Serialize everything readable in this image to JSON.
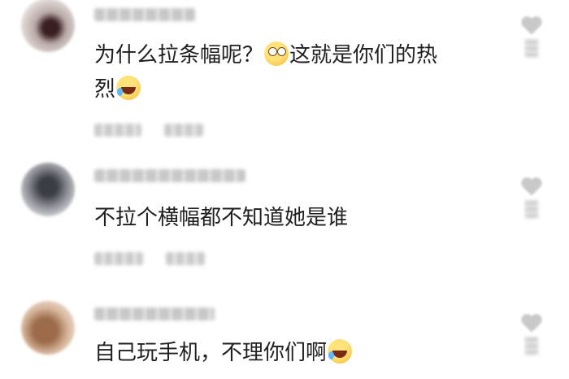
{
  "comments": [
    {
      "text_before": "为什么拉条幅呢？",
      "emoji_1": "rolling-eyes-emoji",
      "text_middle": "这就是你们的热",
      "text_line2": "烈",
      "emoji_2": "laughing-tears-emoji"
    },
    {
      "text": "不拉个横幅都不知道她是谁"
    },
    {
      "text": "自己玩手机，不理你们啊",
      "emoji": "laughing-tears-emoji"
    }
  ],
  "icons": {
    "like": "heart-icon"
  }
}
